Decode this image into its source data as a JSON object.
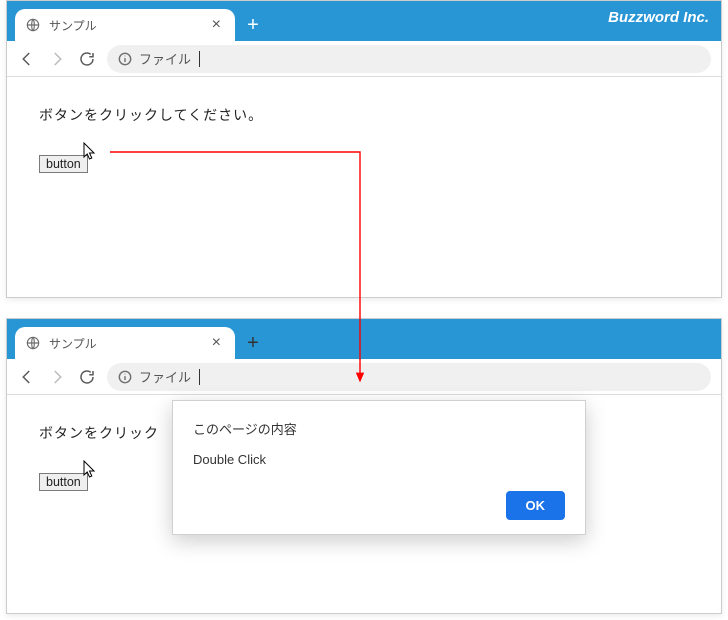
{
  "brand": "Buzzword Inc.",
  "top": {
    "tab_title": "サンプル",
    "addr_label": "ファイル",
    "page_instruction": "ボタンをクリックしてください。",
    "button_label": "button"
  },
  "bottom": {
    "tab_title": "サンプル",
    "addr_label": "ファイル",
    "page_instruction": "ボタンをクリック",
    "button_label": "button"
  },
  "dialog": {
    "title": "このページの内容",
    "message": "Double Click",
    "ok_label": "OK"
  }
}
